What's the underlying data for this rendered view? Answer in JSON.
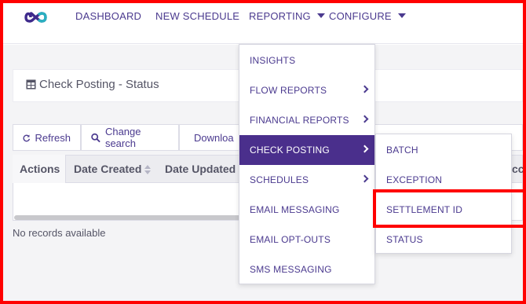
{
  "nav": {
    "dashboard": "DASHBOARD",
    "new_schedule": "NEW SCHEDULE",
    "reporting": "REPORTING",
    "configure": "CONFIGURE"
  },
  "page": {
    "title": "Check Posting - Status"
  },
  "toolbar": {
    "refresh": "Refresh",
    "change_search": "Change search",
    "download": "Downloa"
  },
  "table": {
    "columns": [
      "Actions",
      "Date Created",
      "Date Updated",
      "cc"
    ],
    "empty_text": "No records available"
  },
  "reporting_menu": {
    "items": [
      {
        "label": "INSIGHTS",
        "has_submenu": false
      },
      {
        "label": "FLOW REPORTS",
        "has_submenu": true
      },
      {
        "label": "FINANCIAL REPORTS",
        "has_submenu": true
      },
      {
        "label": "CHECK POSTING",
        "has_submenu": true
      },
      {
        "label": "SCHEDULES",
        "has_submenu": true
      },
      {
        "label": "EMAIL MESSAGING",
        "has_submenu": false
      },
      {
        "label": "EMAIL OPT-OUTS",
        "has_submenu": false
      },
      {
        "label": "SMS MESSAGING",
        "has_submenu": false
      }
    ],
    "active_item": "CHECK POSTING"
  },
  "check_posting_submenu": {
    "items": [
      "BATCH",
      "EXCEPTION",
      "SETTLEMENT ID",
      "STATUS"
    ],
    "highlighted_item": "SETTLEMENT ID"
  },
  "colors": {
    "brand_purple": "#4a2f8c",
    "nav_text": "#4b3a8f",
    "highlight_red": "#ff0000"
  }
}
